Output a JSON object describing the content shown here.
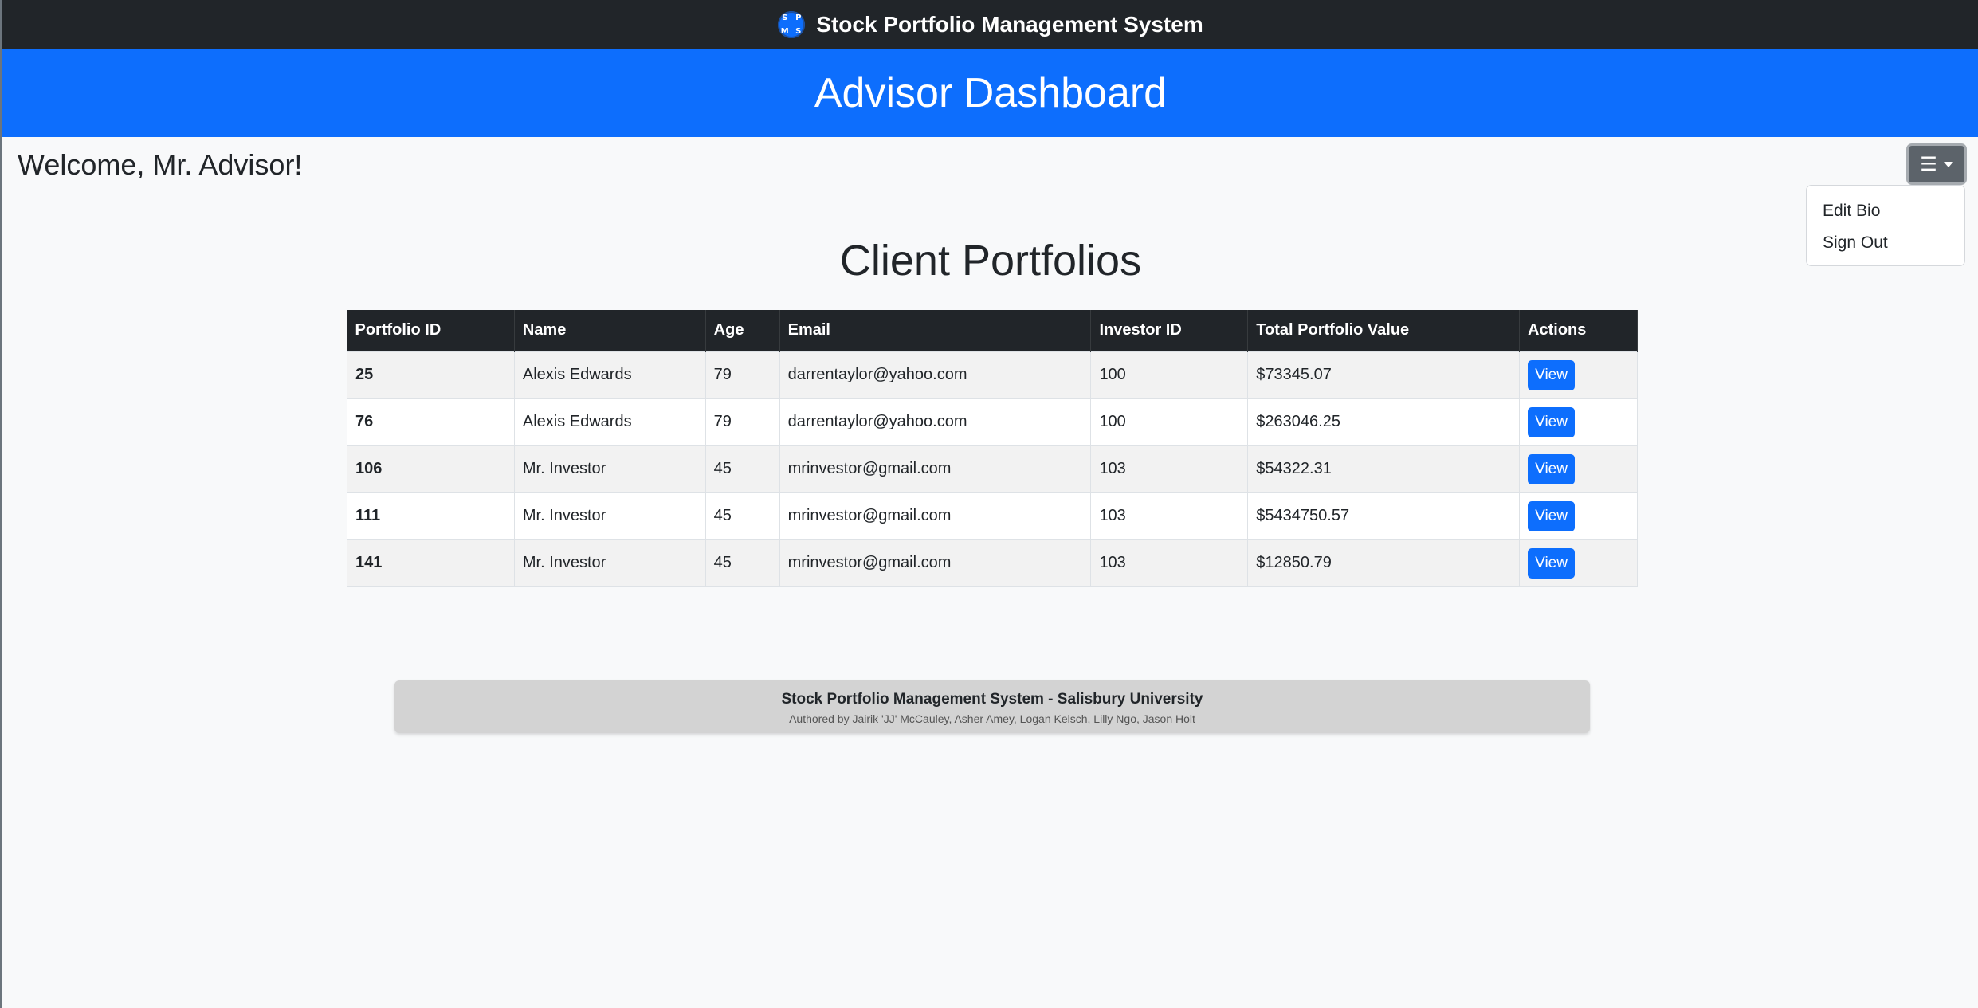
{
  "navbar": {
    "logo_letters": [
      "S",
      "P",
      "M",
      "S"
    ],
    "title": "Stock Portfolio Management System"
  },
  "hero": {
    "title": "Advisor Dashboard"
  },
  "welcome": "Welcome, Mr. Advisor!",
  "menu": {
    "toggle_icon": "☰",
    "items": [
      "Edit Bio",
      "Sign Out"
    ]
  },
  "section_title": "Client Portfolios",
  "table": {
    "headers": [
      "Portfolio ID",
      "Name",
      "Age",
      "Email",
      "Investor ID",
      "Total Portfolio Value",
      "Actions"
    ],
    "rows": [
      {
        "portfolio_id": "25",
        "name": "Alexis Edwards",
        "age": "79",
        "email": "darrentaylor@yahoo.com",
        "investor_id": "100",
        "total": "$73345.07",
        "action": "View"
      },
      {
        "portfolio_id": "76",
        "name": "Alexis Edwards",
        "age": "79",
        "email": "darrentaylor@yahoo.com",
        "investor_id": "100",
        "total": "$263046.25",
        "action": "View"
      },
      {
        "portfolio_id": "106",
        "name": "Mr. Investor",
        "age": "45",
        "email": "mrinvestor@gmail.com",
        "investor_id": "103",
        "total": "$54322.31",
        "action": "View"
      },
      {
        "portfolio_id": "111",
        "name": "Mr. Investor",
        "age": "45",
        "email": "mrinvestor@gmail.com",
        "investor_id": "103",
        "total": "$5434750.57",
        "action": "View"
      },
      {
        "portfolio_id": "141",
        "name": "Mr. Investor",
        "age": "45",
        "email": "mrinvestor@gmail.com",
        "investor_id": "103",
        "total": "$12850.79",
        "action": "View"
      }
    ]
  },
  "footer": {
    "title": "Stock Portfolio Management System - Salisbury University",
    "authors": "Authored by Jairik 'JJ' McCauley, Asher Amey, Logan Kelsch, Lilly Ngo, Jason Holt"
  },
  "colors": {
    "navbar": "#212529",
    "primary": "#0d6efd",
    "background": "#f8f9fa",
    "footer": "#d3d3d3"
  }
}
